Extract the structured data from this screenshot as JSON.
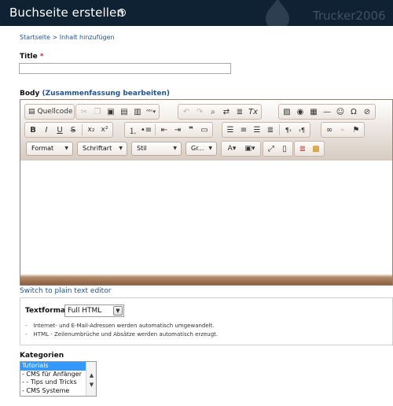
{
  "header": {
    "title": "Buchseite erstellen",
    "add_icon": "plus-circle-icon",
    "watermark": "Trucker2006"
  },
  "breadcrumb": {
    "home": "Startseite",
    "separator": ">",
    "current": "Inhalt hinzufügen"
  },
  "title_field": {
    "label": "Title",
    "required_mark": "*",
    "value": ""
  },
  "body_field": {
    "label": "Body",
    "open_paren": "(",
    "summary_link": "Zusammenfassung bearbeiten",
    "close_paren": ")"
  },
  "toolbar": {
    "source_label": "Quellcode",
    "combos": {
      "format": "Format",
      "font": "Schriftart",
      "style": "Stil",
      "size": "Gr..."
    }
  },
  "plain_text_link": "Switch to plain text editor",
  "text_format": {
    "label": "Textformat",
    "selected": "Full HTML",
    "tips": [
      "Internet- und E-Mail-Adressen werden automatisch umgewandelt.",
      "HTML - Zeilenumbrüche und Absätze werden automatisch erzeugt."
    ]
  },
  "categories": {
    "label": "Kategorien",
    "options": [
      "Tutorials",
      "- CMS für Anfänger",
      "- - Tips und Tricks",
      "- CMS Systeme"
    ],
    "selected": "Tutorials"
  },
  "colors": {
    "header_bg": "#0f2233",
    "link": "#22558f",
    "editor_frame": "#8a5e3f",
    "selection": "#3399ff"
  }
}
